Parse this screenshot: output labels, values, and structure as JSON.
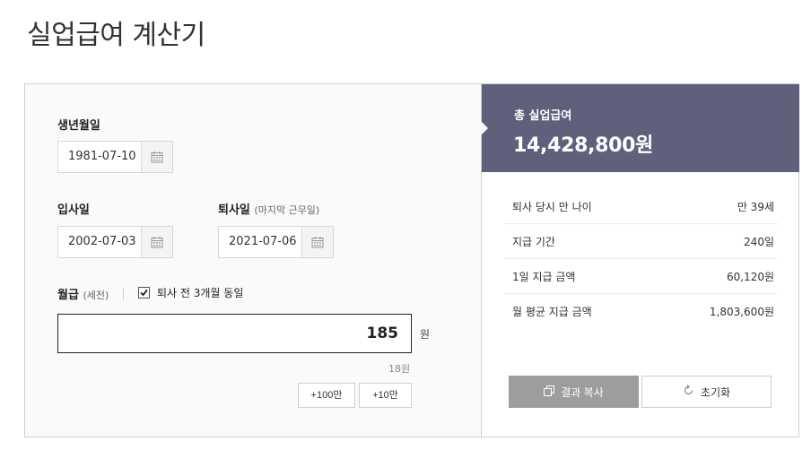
{
  "page": {
    "title": "실업급여 계산기"
  },
  "form": {
    "birth_label": "생년월일",
    "birth_value": "1981-07-10",
    "join_label": "입사일",
    "join_value": "2002-07-03",
    "leave_label": "퇴사일",
    "leave_sub": "(마지막 근무일)",
    "leave_value": "2021-07-06",
    "salary_label": "월급",
    "salary_sub": "(세전)",
    "avg_checkbox_label": "퇴사 전 3개월 동일",
    "avg_checked": true,
    "salary_value": "185",
    "salary_unit": "원",
    "salary_hint": "18원",
    "add_100_label": "+100만",
    "add_10_label": "+10만"
  },
  "result": {
    "caption": "총 실업급여",
    "total": "14,428,800원",
    "rows": [
      {
        "label": "퇴사 당시 만 나이",
        "value": "만 39세"
      },
      {
        "label": "지급 기간",
        "value": "240일"
      },
      {
        "label": "1일 지급 금액",
        "value": "60,120원"
      },
      {
        "label": "월 평균 지급 금액",
        "value": "1,803,600원"
      }
    ],
    "copy_label": "결과 복사",
    "reset_label": "초기화"
  },
  "colors": {
    "result_header_bg": "#5e607c",
    "copy_button_bg": "#9d9d9d"
  },
  "icons": {
    "date_picker": "calendar-icon",
    "copy": "copy-icon",
    "reset": "refresh-icon",
    "check": "checkbox-checked-icon"
  }
}
